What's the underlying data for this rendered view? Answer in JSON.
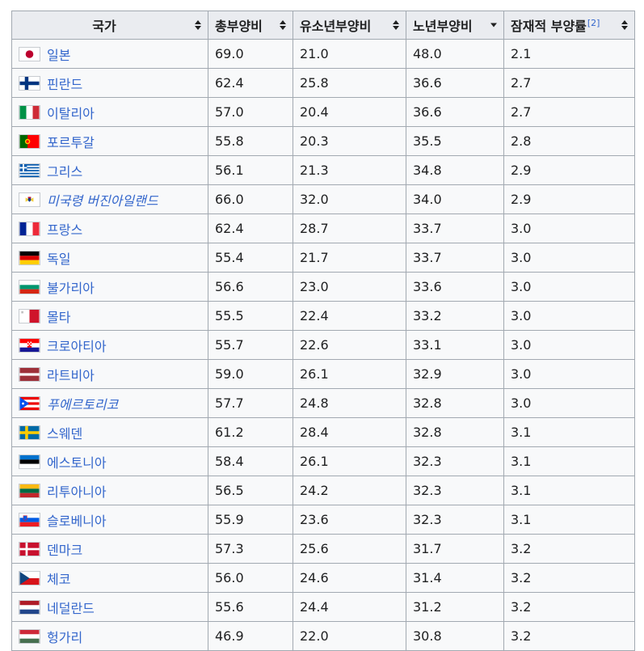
{
  "table": {
    "headers": {
      "country": "국가",
      "total": "총부양비",
      "youth": "유소년부양비",
      "elderly": "노년부양비",
      "potential": "잠재적 부양률",
      "potential_ref": "[2]"
    },
    "sort_state": {
      "elderly": "descending"
    },
    "rows": [
      {
        "country": "일본",
        "flag": "flag-japan-icon",
        "italic": false,
        "total": "69.0",
        "youth": "21.0",
        "elderly": "48.0",
        "potential": "2.1"
      },
      {
        "country": "핀란드",
        "flag": "flag-finland-icon",
        "italic": false,
        "total": "62.4",
        "youth": "25.8",
        "elderly": "36.6",
        "potential": "2.7"
      },
      {
        "country": "이탈리아",
        "flag": "flag-italy-icon",
        "italic": false,
        "total": "57.0",
        "youth": "20.4",
        "elderly": "36.6",
        "potential": "2.7"
      },
      {
        "country": "포르투갈",
        "flag": "flag-portugal-icon",
        "italic": false,
        "total": "55.8",
        "youth": "20.3",
        "elderly": "35.5",
        "potential": "2.8"
      },
      {
        "country": "그리스",
        "flag": "flag-greece-icon",
        "italic": false,
        "total": "56.1",
        "youth": "21.3",
        "elderly": "34.8",
        "potential": "2.9"
      },
      {
        "country": "미국령 버진아일랜드",
        "flag": "flag-us-virgin-islands-icon",
        "italic": true,
        "total": "66.0",
        "youth": "32.0",
        "elderly": "34.0",
        "potential": "2.9"
      },
      {
        "country": "프랑스",
        "flag": "flag-france-icon",
        "italic": false,
        "total": "62.4",
        "youth": "28.7",
        "elderly": "33.7",
        "potential": "3.0"
      },
      {
        "country": "독일",
        "flag": "flag-germany-icon",
        "italic": false,
        "total": "55.4",
        "youth": "21.7",
        "elderly": "33.7",
        "potential": "3.0"
      },
      {
        "country": "불가리아",
        "flag": "flag-bulgaria-icon",
        "italic": false,
        "total": "56.6",
        "youth": "23.0",
        "elderly": "33.6",
        "potential": "3.0"
      },
      {
        "country": "몰타",
        "flag": "flag-malta-icon",
        "italic": false,
        "total": "55.5",
        "youth": "22.4",
        "elderly": "33.2",
        "potential": "3.0"
      },
      {
        "country": "크로아티아",
        "flag": "flag-croatia-icon",
        "italic": false,
        "total": "55.7",
        "youth": "22.6",
        "elderly": "33.1",
        "potential": "3.0"
      },
      {
        "country": "라트비아",
        "flag": "flag-latvia-icon",
        "italic": false,
        "total": "59.0",
        "youth": "26.1",
        "elderly": "32.9",
        "potential": "3.0"
      },
      {
        "country": "푸에르토리코",
        "flag": "flag-puerto-rico-icon",
        "italic": true,
        "total": "57.7",
        "youth": "24.8",
        "elderly": "32.8",
        "potential": "3.0"
      },
      {
        "country": "스웨덴",
        "flag": "flag-sweden-icon",
        "italic": false,
        "total": "61.2",
        "youth": "28.4",
        "elderly": "32.8",
        "potential": "3.1"
      },
      {
        "country": "에스토니아",
        "flag": "flag-estonia-icon",
        "italic": false,
        "total": "58.4",
        "youth": "26.1",
        "elderly": "32.3",
        "potential": "3.1"
      },
      {
        "country": "리투아니아",
        "flag": "flag-lithuania-icon",
        "italic": false,
        "total": "56.5",
        "youth": "24.2",
        "elderly": "32.3",
        "potential": "3.1"
      },
      {
        "country": "슬로베니아",
        "flag": "flag-slovenia-icon",
        "italic": false,
        "total": "55.9",
        "youth": "23.6",
        "elderly": "32.3",
        "potential": "3.1"
      },
      {
        "country": "덴마크",
        "flag": "flag-denmark-icon",
        "italic": false,
        "total": "57.3",
        "youth": "25.6",
        "elderly": "31.7",
        "potential": "3.2"
      },
      {
        "country": "체코",
        "flag": "flag-czechia-icon",
        "italic": false,
        "total": "56.0",
        "youth": "24.6",
        "elderly": "31.4",
        "potential": "3.2"
      },
      {
        "country": "네덜란드",
        "flag": "flag-netherlands-icon",
        "italic": false,
        "total": "55.6",
        "youth": "24.4",
        "elderly": "31.2",
        "potential": "3.2"
      },
      {
        "country": "헝가리",
        "flag": "flag-hungary-icon",
        "italic": false,
        "total": "46.9",
        "youth": "22.0",
        "elderly": "30.8",
        "potential": "3.2"
      }
    ]
  },
  "colors": {
    "link": "#3366cc",
    "header_bg": "#eaecf0",
    "cell_bg": "#f8f9fa",
    "border": "#a2a9b1",
    "text": "#202122"
  }
}
